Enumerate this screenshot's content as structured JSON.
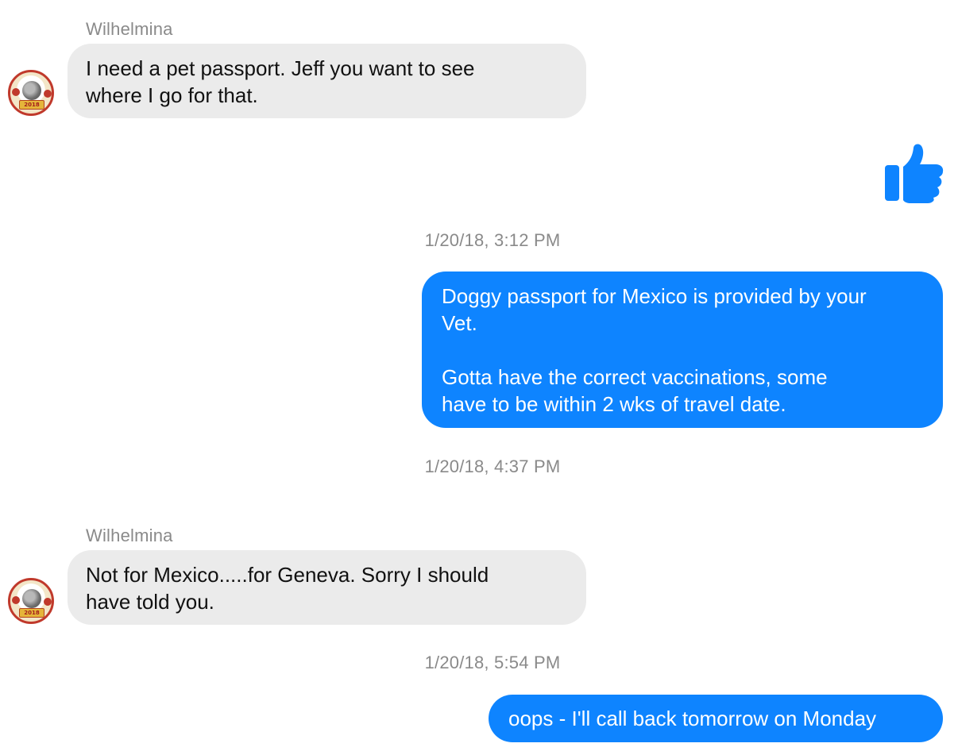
{
  "conversation": {
    "messages": [
      {
        "sender": "Wilhelmina",
        "direction": "incoming",
        "lines": [
          "I need a pet passport. Jeff you want to see",
          "where I go for that."
        ]
      },
      {
        "direction": "outgoing",
        "reaction": "thumbs-up-icon"
      },
      {
        "timestamp": "1/20/18, 3:12 PM",
        "direction": "outgoing",
        "lines": [
          "Doggy passport for Mexico is provided by your",
          "Vet.",
          "",
          "Gotta have the correct vaccinations, some",
          "have to be within 2 wks of travel date."
        ]
      },
      {
        "timestamp": "1/20/18, 4:37 PM"
      },
      {
        "sender": "Wilhelmina",
        "direction": "incoming",
        "lines": [
          "Not for Mexico.....for Geneva. Sorry I should",
          "have told you."
        ]
      },
      {
        "timestamp": "1/20/18, 5:54 PM",
        "direction": "outgoing",
        "lines": [
          "oops - I'll call back tomorrow on Monday"
        ]
      }
    ],
    "avatar": {
      "badge_text": "2018"
    }
  },
  "colors": {
    "outgoing_bubble": "#0e84ff",
    "incoming_bubble": "#ebebeb",
    "timestamp_text": "#8a8a8a",
    "thumbs_up": "#0e84ff"
  }
}
